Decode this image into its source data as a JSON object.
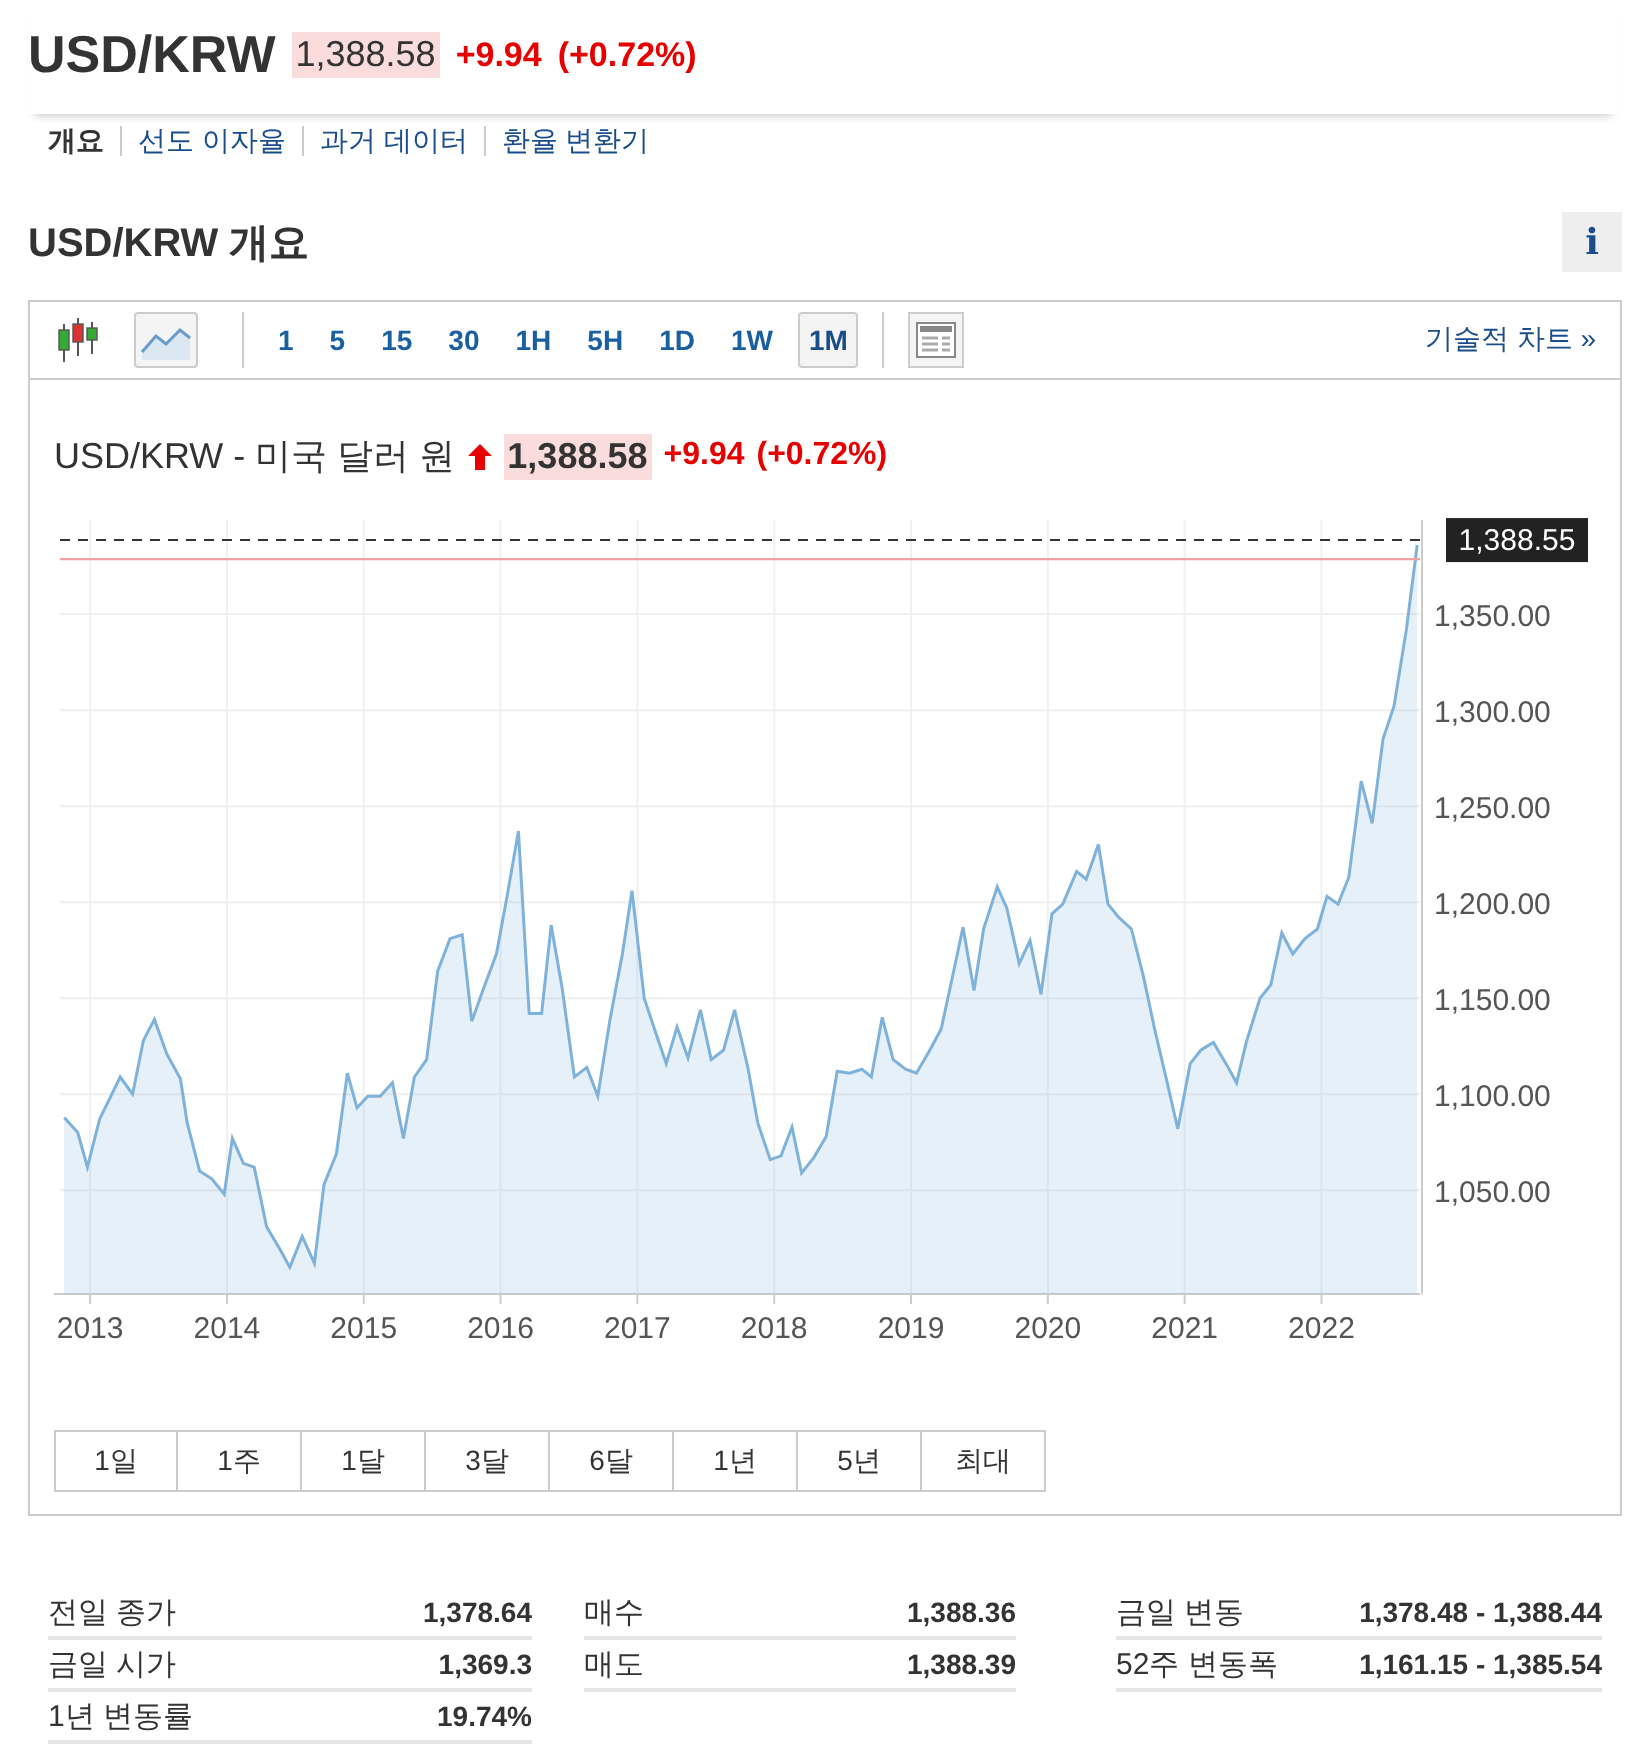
{
  "header": {
    "symbol": "USD/KRW",
    "price": "1,388.58",
    "change": "+9.94",
    "change_pct": "(+0.72%)"
  },
  "nav_tabs": [
    {
      "label": "개요",
      "selected": true
    },
    {
      "label": "선도 이자율",
      "selected": false
    },
    {
      "label": "과거 데이터",
      "selected": false
    },
    {
      "label": "환율 변환기",
      "selected": false
    }
  ],
  "section": {
    "title": "USD/KRW 개요",
    "info_button": "i"
  },
  "toolbar": {
    "chart_types": [
      {
        "kind": "candlestick",
        "selected": false
      },
      {
        "kind": "line",
        "selected": true
      }
    ],
    "intervals": [
      {
        "label": "1",
        "selected": false
      },
      {
        "label": "5",
        "selected": false
      },
      {
        "label": "15",
        "selected": false
      },
      {
        "label": "30",
        "selected": false
      },
      {
        "label": "1H",
        "selected": false
      },
      {
        "label": "5H",
        "selected": false
      },
      {
        "label": "1D",
        "selected": false
      },
      {
        "label": "1W",
        "selected": false
      },
      {
        "label": "1M",
        "selected": true
      }
    ],
    "technical_link": "기술적 차트 »"
  },
  "chart_header": {
    "name": "USD/KRW - 미국 달러 원",
    "kind": "up",
    "price": "1,388.58",
    "change": "+9.94",
    "change_pct": "(+0.72%)"
  },
  "chart_data": {
    "type": "area",
    "x": [
      2012.81,
      2012.91,
      2012.98,
      2013.07,
      2013.22,
      2013.31,
      2013.39,
      2013.47,
      2013.56,
      2013.66,
      2013.71,
      2013.8,
      2013.89,
      2013.98,
      2014.04,
      2014.12,
      2014.2,
      2014.29,
      2014.39,
      2014.46,
      2014.55,
      2014.64,
      2014.71,
      2014.8,
      2014.88,
      2014.95,
      2015.03,
      2015.12,
      2015.21,
      2015.29,
      2015.37,
      2015.46,
      2015.54,
      2015.63,
      2015.72,
      2015.79,
      2015.88,
      2015.97,
      2016.05,
      2016.13,
      2016.21,
      2016.3,
      2016.37,
      2016.45,
      2016.54,
      2016.63,
      2016.71,
      2016.8,
      2016.89,
      2016.96,
      2017.05,
      2017.12,
      2017.21,
      2017.29,
      2017.37,
      2017.46,
      2017.54,
      2017.63,
      2017.71,
      2017.81,
      2017.88,
      2017.97,
      2018.05,
      2018.13,
      2018.2,
      2018.29,
      2018.38,
      2018.46,
      2018.55,
      2018.64,
      2018.71,
      2018.79,
      2018.87,
      2018.96,
      2019.04,
      2019.13,
      2019.22,
      2019.3,
      2019.38,
      2019.46,
      2019.53,
      2019.63,
      2019.7,
      2019.79,
      2019.87,
      2019.95,
      2020.03,
      2020.11,
      2020.21,
      2020.28,
      2020.37,
      2020.44,
      2020.52,
      2020.61,
      2020.7,
      2020.78,
      2020.87,
      2020.95,
      2021.04,
      2021.12,
      2021.21,
      2021.31,
      2021.38,
      2021.45,
      2021.55,
      2021.63,
      2021.71,
      2021.79,
      2021.88,
      2021.97,
      2022.04,
      2022.12,
      2022.2,
      2022.29,
      2022.37,
      2022.45,
      2022.53,
      2022.62,
      2022.7
    ],
    "series": [
      {
        "color": "#7fb2db",
        "values": [
          1088,
          1080,
          1062,
          1087,
          1109,
          1100,
          1128,
          1139,
          1121,
          1108,
          1085,
          1060,
          1056,
          1048,
          1077,
          1064,
          1062,
          1031,
          1019,
          1010,
          1026,
          1012,
          1053,
          1069,
          1111,
          1093,
          1099,
          1099,
          1106,
          1077,
          1109,
          1118,
          1164,
          1181,
          1183,
          1138,
          1156,
          1173,
          1204,
          1237,
          1142,
          1142,
          1188,
          1155,
          1109,
          1114,
          1099,
          1139,
          1173,
          1206,
          1150,
          1135,
          1116,
          1135,
          1119,
          1144,
          1118,
          1123,
          1144,
          1113,
          1085,
          1066,
          1068,
          1083,
          1059,
          1067,
          1078,
          1112,
          1111,
          1113,
          1109,
          1140,
          1118,
          1113,
          1111,
          1122,
          1134,
          1160,
          1187,
          1154,
          1186,
          1208,
          1197,
          1168,
          1180,
          1152,
          1194,
          1199,
          1216,
          1212,
          1230,
          1199,
          1192,
          1186,
          1161,
          1134,
          1107,
          1082,
          1116,
          1123,
          1127,
          1115,
          1106,
          1127,
          1150,
          1157,
          1184,
          1173,
          1181,
          1186,
          1203,
          1199,
          1213,
          1263,
          1241,
          1285,
          1302,
          1342,
          1386
        ]
      }
    ],
    "xlim": [
      2012.78,
      2022.72
    ],
    "ylim": [
      996,
      1399
    ],
    "xticks": [
      2013,
      2014,
      2015,
      2016,
      2017,
      2018,
      2019,
      2020,
      2021,
      2022
    ],
    "yticks": [
      {
        "value": 1050,
        "label": "1,050.00"
      },
      {
        "value": 1100,
        "label": "1,100.00"
      },
      {
        "value": 1150,
        "label": "1,150.00"
      },
      {
        "value": 1200,
        "label": "1,200.00"
      },
      {
        "value": 1250,
        "label": "1,250.00"
      },
      {
        "value": 1300,
        "label": "1,300.00"
      },
      {
        "value": 1350,
        "label": "1,350.00"
      }
    ],
    "grid": true,
    "ref_lines": [
      {
        "axis": "y",
        "value": 1388.55,
        "label": "1,388.55",
        "color": "#333333"
      },
      {
        "axis": "y",
        "value": 1378.64,
        "color": "#f0a0a0"
      }
    ]
  },
  "ranges": [
    "1일",
    "1주",
    "1달",
    "3달",
    "6달",
    "1년",
    "5년",
    "최대"
  ],
  "stats": [
    [
      {
        "label": "전일 종가",
        "value": "1,378.64"
      },
      {
        "label": "금일 시가",
        "value": "1,369.3"
      },
      {
        "label": "1년 변동률",
        "value": "19.74%"
      }
    ],
    [
      {
        "label": "매수",
        "value": "1,388.36"
      },
      {
        "label": "매도",
        "value": "1,388.39"
      }
    ],
    [
      {
        "label": "금일 변동",
        "value": "1,378.48 - 1,388.44"
      },
      {
        "label": "52주 변동폭",
        "value": "1,161.15 - 1,385.54"
      }
    ]
  ]
}
